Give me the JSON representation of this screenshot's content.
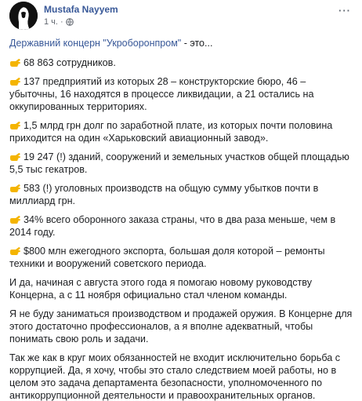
{
  "post": {
    "author": "Mustafa Nayyem",
    "time": "1 ч.",
    "separator": "·",
    "more_label": "···",
    "title_link": "Державний концерн \"Укроборонпром\"",
    "title_rest": " - это...",
    "bullets": [
      "68 863 сотрудников.",
      "137 предприятий из которых 28 – конструкторские бюро, 46 – убыточны, 16 находятся в процессе ликвидации, а 21 остались на оккупированных территориях.",
      "1,5 млрд грн долг по заработной плате, из которых почти половина приходится на один «Харьковский авиационный завод».",
      "19 247 (!) зданий, сооружений и земельных участков общей площадью 5,5 тыс гекатров.",
      "583 (!) уголовных производств на общую сумму убытков почти в миллиард грн.",
      "34% всего оборонного заказа страны, что в два раза меньше, чем в 2014 году.",
      "$800 млн ежегодного экспорта, большая доля которой – ремонты техники и вооружений советского периода."
    ],
    "paragraphs": [
      "И да, начиная с августа этого года я помогаю новому руководству Концерна, а с 11 ноября официально стал членом команды.",
      "Я не буду заниматься производством и продажей оружия. В Концерне для этого достаточно профессионалов, а я вполне адекватный, чтобы понимать свою роль и задачи.",
      "Так же как в круг моих обязанностей не входит исключительно борьба с коррупцией. Да, я хочу, чтобы это стало следствием моей работы, но в целом это задача департамента безопасности, уполномоченного по антикоррупционной деятельности и правоохранительных органов."
    ]
  },
  "icons": {
    "avatar": "avatar-silhouette",
    "privacy": "globe-icon",
    "bullet": "pointing-hand-icon",
    "more": "more-options-icon"
  },
  "colors": {
    "link": "#385898",
    "text": "#1c1e21",
    "meta": "#616770",
    "hand": "#f4b400"
  }
}
